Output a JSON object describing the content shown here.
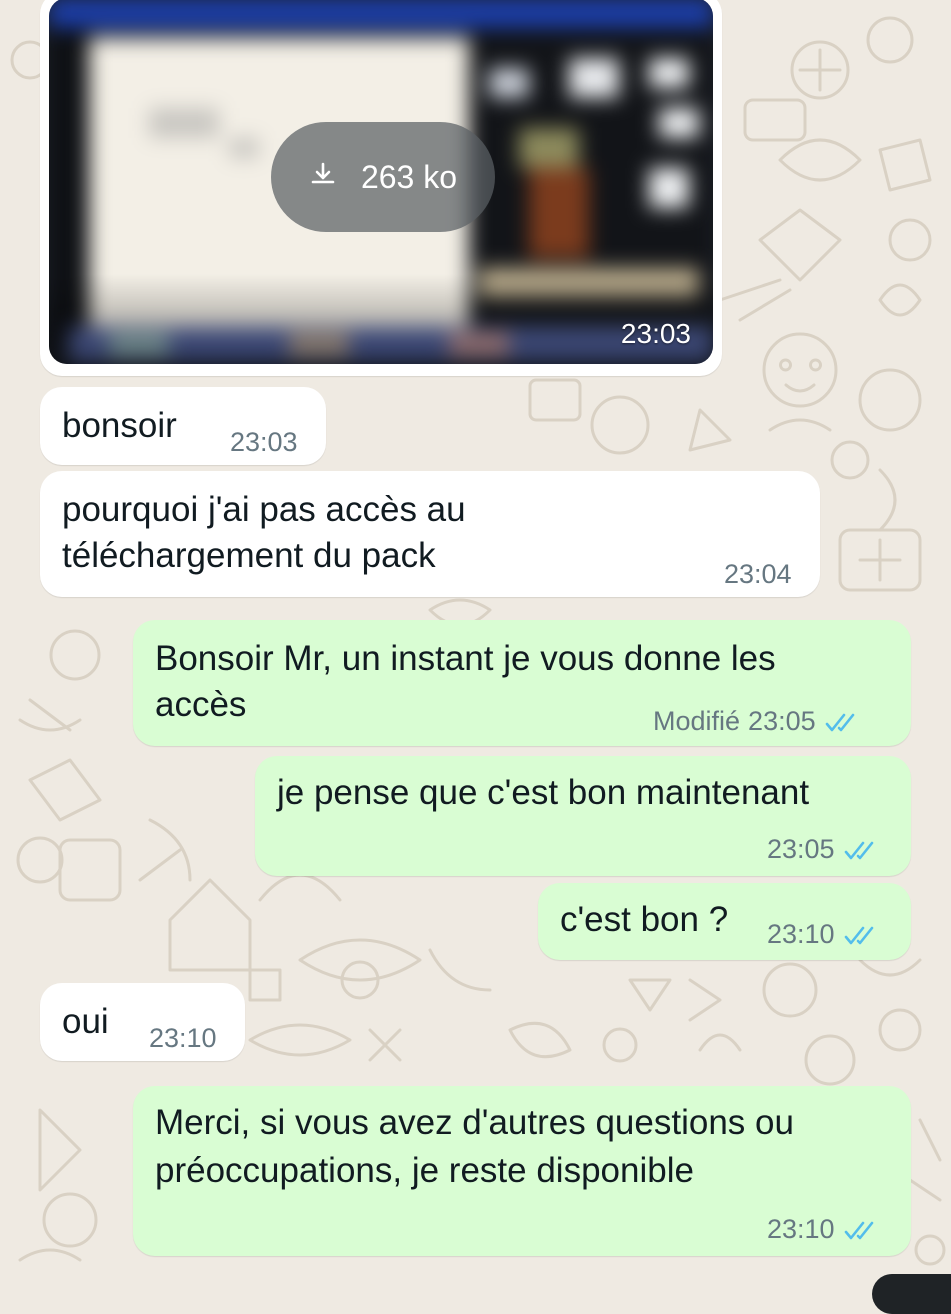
{
  "chat": {
    "attachment": {
      "size_label": "263 ko",
      "time": "23:03",
      "download_icon": "download-icon"
    },
    "messages": [
      {
        "direction": "in",
        "text_lines": [
          "bonsoir"
        ],
        "time": "23:03"
      },
      {
        "direction": "in",
        "text_lines": [
          "pourquoi j'ai pas accès au",
          "téléchargement du pack"
        ],
        "time": "23:04"
      },
      {
        "direction": "out",
        "text_lines": [
          "Bonsoir Mr, un instant je vous donne les",
          "accès"
        ],
        "edited_label": "Modifié",
        "time": "23:05",
        "status": "read"
      },
      {
        "direction": "out",
        "text_lines": [
          "je pense que c'est bon maintenant"
        ],
        "time": "23:05",
        "status": "read"
      },
      {
        "direction": "out",
        "text_lines": [
          "c'est bon ?"
        ],
        "time": "23:10",
        "status": "read"
      },
      {
        "direction": "in",
        "text_lines": [
          "oui"
        ],
        "time": "23:10"
      },
      {
        "direction": "out",
        "text_lines": [
          "Merci, si vous avez d'autres questions ou",
          "préoccupations, je reste disponible"
        ],
        "time": "23:10",
        "status": "read"
      }
    ]
  },
  "colors": {
    "background": "#efeae2",
    "incoming_bubble": "#ffffff",
    "outgoing_bubble": "#d9fdd3",
    "text": "#111b21",
    "meta_text": "#667781",
    "read_ticks": "#53bdeb"
  }
}
